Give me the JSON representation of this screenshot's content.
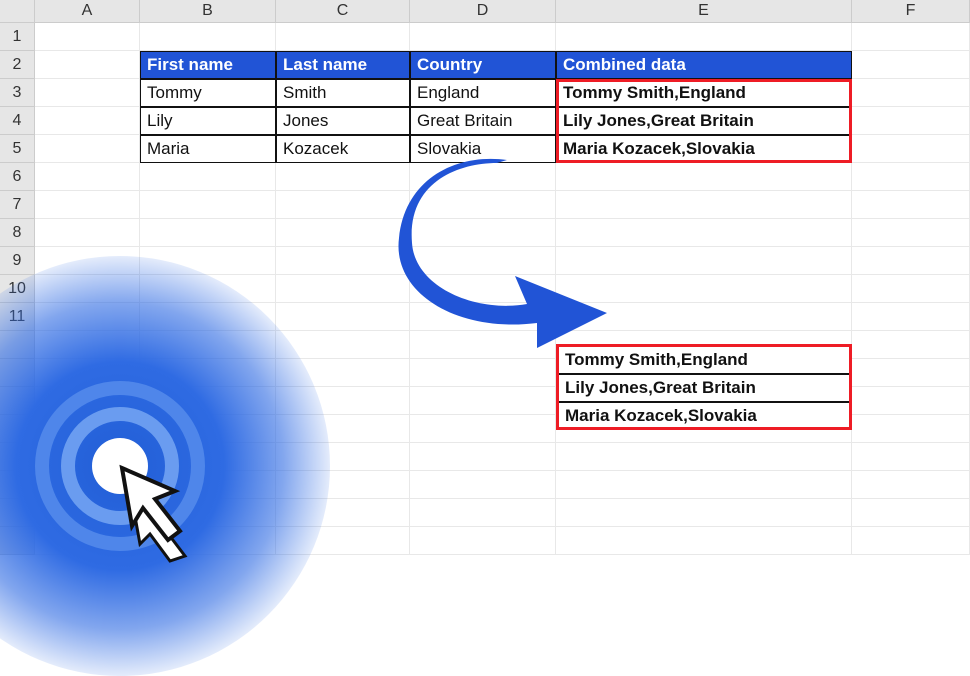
{
  "columns": {
    "A": "A",
    "B": "B",
    "C": "C",
    "D": "D",
    "E": "E",
    "F": "F"
  },
  "rows": {
    "r1": "1",
    "r2": "2",
    "r3": "3",
    "r4": "4",
    "r5": "5",
    "r6": "6",
    "r7": "7",
    "r8": "8",
    "r9": "9",
    "r10": "10",
    "r11": "11"
  },
  "header": {
    "first_name": "First name",
    "last_name": "Last name",
    "country": "Country",
    "combined": "Combined data"
  },
  "rowsData": [
    {
      "first": "Tommy",
      "last": "Smith",
      "country": "England",
      "combined": "Tommy Smith,England"
    },
    {
      "first": "Lily",
      "last": "Jones",
      "country": "Great Britain",
      "combined": "Lily  Jones,Great Britain"
    },
    {
      "first": "Maria",
      "last": "Kozacek",
      "country": "Slovakia",
      "combined": "Maria Kozacek,Slovakia"
    }
  ],
  "chart_data": {
    "type": "table",
    "columns": [
      "First name",
      "Last name",
      "Country",
      "Combined data"
    ],
    "rows": [
      [
        "Tommy",
        "Smith",
        "England",
        "Tommy Smith,England"
      ],
      [
        "Lily",
        "Jones",
        "Great Britain",
        "Lily  Jones,Great Britain"
      ],
      [
        "Maria",
        "Kozacek",
        "Slovakia",
        "Maria Kozacek,Slovakia"
      ]
    ]
  },
  "colors": {
    "header_bg": "#2154d6",
    "highlight": "#ee1c25",
    "grid": "#e8e8e8"
  }
}
